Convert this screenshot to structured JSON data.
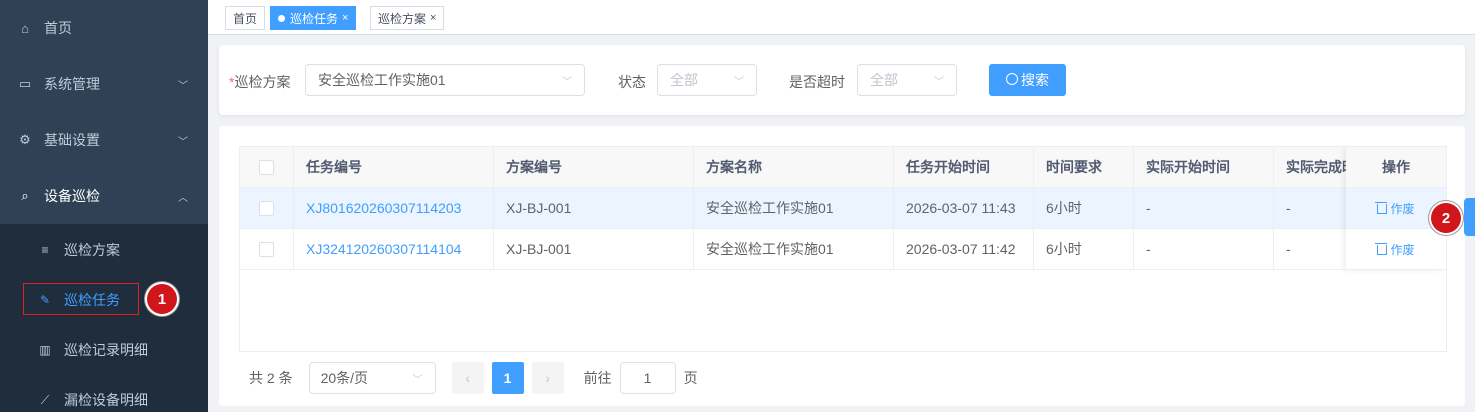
{
  "sidebar": {
    "items": [
      {
        "label": "首页",
        "icon": "home-icon"
      },
      {
        "label": "系统管理",
        "icon": "monitor-icon"
      },
      {
        "label": "基础设置",
        "icon": "gear-icon"
      },
      {
        "label": "设备巡检",
        "icon": "search-icon"
      }
    ],
    "subitems": [
      {
        "label": "巡检方案",
        "icon": "list-icon"
      },
      {
        "label": "巡检任务",
        "icon": "edit-icon"
      },
      {
        "label": "巡检记录明细",
        "icon": "bar-chart-icon"
      },
      {
        "label": "漏检设备明细",
        "icon": "line-chart-icon"
      }
    ]
  },
  "markers": [
    "1",
    "2"
  ],
  "tags": [
    {
      "label": "首页"
    },
    {
      "label": "巡检任务",
      "close": "×"
    },
    {
      "label": "巡检方案",
      "close": "×"
    }
  ],
  "search": {
    "plan_label": "巡检方案",
    "plan_required": "*",
    "plan_value": "安全巡检工作实施01",
    "status_label": "状态",
    "status_placeholder": "全部",
    "overtime_label": "是否超时",
    "overtime_placeholder": "全部",
    "search_button": "搜索"
  },
  "table": {
    "headers": [
      "任务编号",
      "方案编号",
      "方案名称",
      "任务开始时间",
      "时间要求",
      "实际开始时间",
      "实际完成时",
      "操作"
    ],
    "rows": [
      {
        "task_no": "XJ801620260307114203",
        "plan_no": "XJ-BJ-001",
        "plan_name": "安全巡检工作实施01",
        "start_time": "2026-03-07 11:43",
        "time_req": "6小时",
        "actual_start": "-",
        "actual_end": "-",
        "action": "作废"
      },
      {
        "task_no": "XJ324120260307114104",
        "plan_no": "XJ-BJ-001",
        "plan_name": "安全巡检工作实施01",
        "start_time": "2026-03-07 11:42",
        "time_req": "6小时",
        "actual_start": "-",
        "actual_end": "-",
        "action": "作废"
      }
    ]
  },
  "pagination": {
    "total": "共 2 条",
    "page_size": "20条/页",
    "current_page": "1",
    "goto_label": "前往",
    "goto_value": "1",
    "page_suffix": "页",
    "prev": "‹",
    "next": "›"
  },
  "colors": {
    "sidebar_bg": "#304156",
    "accent": "#409eff",
    "marker": "#d0161b"
  }
}
